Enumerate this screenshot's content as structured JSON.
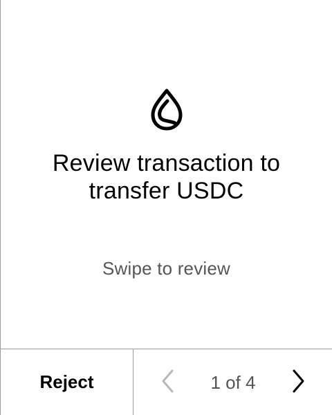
{
  "review": {
    "title_line1": "Review transaction to",
    "title_line2": "transfer USDC",
    "hint": "Swipe to review"
  },
  "footer": {
    "reject_label": "Reject",
    "page_indicator": "1 of 4",
    "current_page": 1,
    "total_pages": 4
  },
  "colors": {
    "text_primary": "#000000",
    "text_secondary": "#555555",
    "disabled_icon": "#b8b8b8",
    "divider": "#9a9a9a"
  },
  "icons": {
    "logo": "droplet-logo-icon",
    "prev": "chevron-left-icon",
    "next": "chevron-right-icon"
  }
}
